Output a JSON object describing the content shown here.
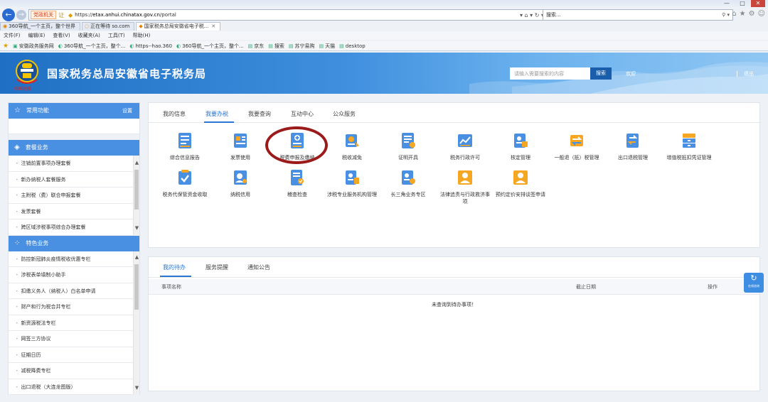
{
  "browser": {
    "window_controls": [
      "—",
      "□",
      "✕"
    ],
    "nav": {
      "back": "←",
      "forward": "→"
    },
    "address_tag": "党政机关",
    "address_tag_mark": "证",
    "url_prefix": "https://",
    "url_host": "etax.anhui.chinatax.gov.cn",
    "url_path": "/portal",
    "address_right": "▾  ⌂ ▾  ↻ ▾",
    "search_text": "搜索...",
    "search_icon": "⚲ ▾",
    "chrome_icons": [
      "⌂",
      "★",
      "⚙",
      "☺"
    ],
    "tabs": [
      {
        "label": "360导航_一个主页，整个世界",
        "active": false
      },
      {
        "label": "正在等待 so.com",
        "active": false
      },
      {
        "label": "国家税务总局安徽省电子税...",
        "active": true
      }
    ],
    "menu": [
      "文件(F)",
      "编辑(E)",
      "查看(V)",
      "收藏夹(A)",
      "工具(T)",
      "帮助(H)"
    ],
    "favorites": [
      "安徽政务服务网",
      "360导航_一个主页，整个...",
      "https--hao.360",
      "360导航_一个主页，整个...",
      "京东",
      "搜索",
      "苏宁易购",
      "天猫",
      "desktop"
    ]
  },
  "header": {
    "logo_text": "中国税务",
    "title": "国家税务总局安徽省电子税务局",
    "search_placeholder": "请输入需要搜索的内容",
    "search_button": "搜索",
    "user": "欢迎",
    "logout": "退出"
  },
  "sidebar": {
    "common": {
      "title": "常用功能",
      "action": "设置"
    },
    "package": {
      "title": "套餐业务",
      "items": [
        "注销前置事项办理套餐",
        "新办纳税人套餐服务",
        "主附税（费）联合申报套餐",
        "发票套餐",
        "跨区域涉税事项综合办理套餐"
      ]
    },
    "special": {
      "title": "特色业务",
      "items": [
        "防控新冠肺炎疫情税收优惠专栏",
        "涉税表单填制小助手",
        "扣缴义务人（纳税人）白名单申请",
        "财产和行为税合并专栏",
        "新资源税法专栏",
        "网签三方协议",
        "征期日历",
        "减税降费专栏",
        "出口退税（大连龙图版）"
      ]
    }
  },
  "services": {
    "tabs": [
      "我的信息",
      "我要办税",
      "我要查询",
      "互动中心",
      "公众服务"
    ],
    "active_tab": 1,
    "items": [
      {
        "label": "综合信息报告",
        "icon": "doc-icon"
      },
      {
        "label": "发票使用",
        "icon": "invoice-icon"
      },
      {
        "label": "税费申报及缴纳",
        "icon": "tax-declare-icon"
      },
      {
        "label": "税收减免",
        "icon": "tax-relief-icon"
      },
      {
        "label": "证明开具",
        "icon": "certificate-icon"
      },
      {
        "label": "税务行政许可",
        "icon": "permit-chart-icon"
      },
      {
        "label": "核定管理",
        "icon": "assessment-icon"
      },
      {
        "label": "一般退（抵）税管理",
        "icon": "refund-icon"
      },
      {
        "label": "出口退税管理",
        "icon": "export-refund-icon"
      },
      {
        "label": "增值税抵扣凭证管理",
        "icon": "vat-voucher-icon"
      },
      {
        "label": "税务代保管资金收取",
        "icon": "custody-fund-icon"
      },
      {
        "label": "纳税信用",
        "icon": "credit-icon"
      },
      {
        "label": "稽查检查",
        "icon": "inspection-icon"
      },
      {
        "label": "涉税专业服务机构管理",
        "icon": "agency-icon"
      },
      {
        "label": "长三角业务专区",
        "icon": "yangtze-icon"
      },
      {
        "label": "法律追责与行政救济事项",
        "icon": "legal-icon"
      },
      {
        "label": "预约定价安排谈签申请",
        "icon": "pricing-icon"
      }
    ]
  },
  "todo": {
    "tabs": [
      "我的待办",
      "服务提醒",
      "通知公告"
    ],
    "active_tab": 0,
    "columns": [
      "事项名称",
      "截止日期",
      "操作"
    ],
    "empty_text": "未查询到待办事项！"
  },
  "float_button": {
    "label": "在线咨询",
    "icon": "↻"
  },
  "colors": {
    "primary": "#2a76d2",
    "sidebar_head": "#4a90e2",
    "annotation": "#9b1b1b"
  }
}
